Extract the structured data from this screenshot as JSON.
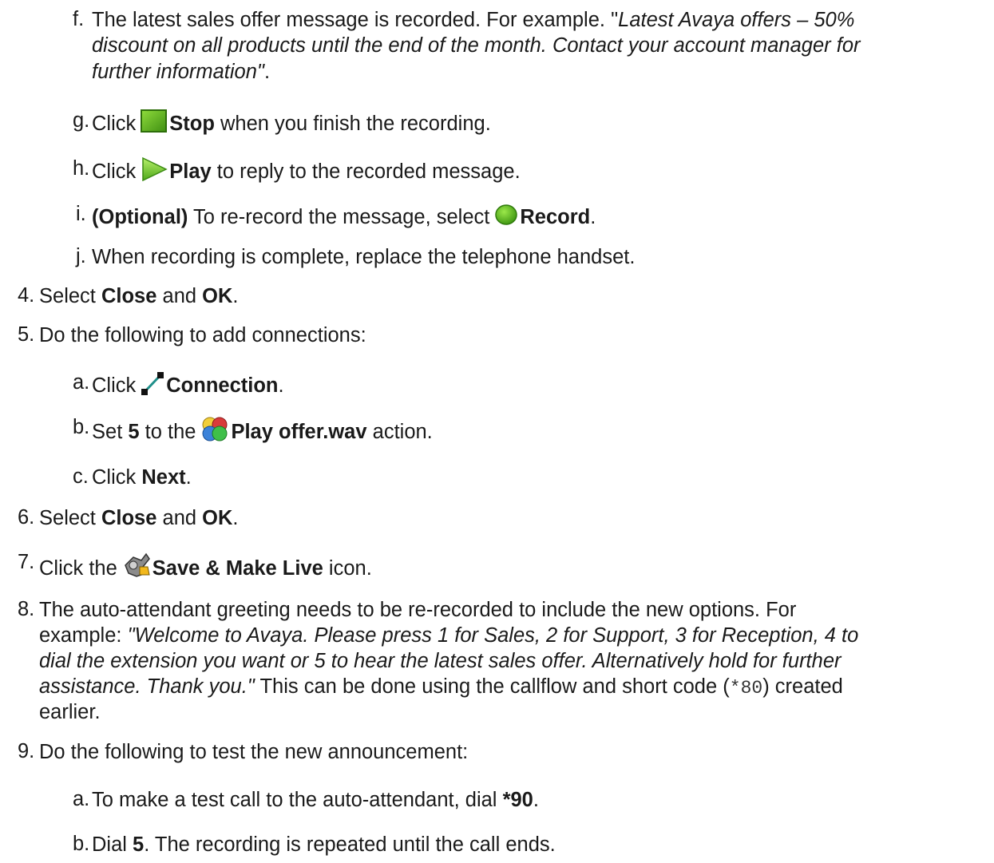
{
  "top_steps": [
    {
      "marker": "f.",
      "lines": [
        [
          "The latest sales offer message is recorded. For example. \"",
          "Latest Avaya offers – 50%"
        ],
        [
          "discount on all products until the end of the month. Contact your account manager for"
        ],
        [
          "further information\"",
          "."
        ]
      ]
    },
    {
      "marker": "g.",
      "before": "Click",
      "icon": "stop-square-icon",
      "bold": "Stop",
      "after": " when you finish the recording.",
      "icon_color": "#5fb41e"
    },
    {
      "marker": "h.",
      "before": "Click",
      "icon": "play-triangle-icon",
      "bold": "Play",
      "after": " to reply to the recorded message.",
      "icon_color": "#7ac943"
    },
    {
      "marker": "i.",
      "bold_lead": "(Optional)",
      "before": " To re-record the message, select",
      "icon": "record-circle-icon",
      "bold": "Record",
      "after": ".",
      "icon_color": "#6cc01f"
    },
    {
      "marker": "j.",
      "text": "When recording is complete, replace the telephone handset."
    }
  ],
  "step4": {
    "marker": "4.",
    "before": "Select ",
    "b1": "Close",
    "mid": " and ",
    "b2": "OK",
    "after": "."
  },
  "step5": {
    "marker": "5.",
    "text": "Do the following to add connections:",
    "subs": [
      {
        "marker": "a.",
        "before": "Click",
        "icon": "connection-line-icon",
        "bold": "Connection",
        "after": "."
      },
      {
        "marker": "b.",
        "before": "Set ",
        "b_num": "5",
        "mid": " to the",
        "icon": "action-puzzle-icon",
        "bold": "Play offer.wav",
        "after": " action."
      },
      {
        "marker": "c.",
        "before": "Click ",
        "bold": "Next",
        "after": "."
      }
    ]
  },
  "step6": {
    "marker": "6.",
    "before": "Select ",
    "b1": "Close",
    "mid": " and ",
    "b2": "OK",
    "after": "."
  },
  "step7": {
    "marker": "7.",
    "before": "Click the",
    "icon": "save-make-live-icon",
    "bold": "Save & Make Live",
    "after": " icon."
  },
  "step8": {
    "marker": "8.",
    "l1": "The auto-attendant greeting needs to be re-recorded to include the new options. For",
    "l2a": "example: ",
    "l2b": "\"Welcome to Avaya. Please press 1 for Sales, 2 for Support, 3 for Reception, 4 to",
    "l3": "dial the extension you want or 5 to hear the latest sales offer. Alternatively hold for further",
    "l4a": "assistance. Thank you.\"",
    "l4b": " This can be done using the callflow and short code (",
    "l4code": "*80",
    "l4c": ") created",
    "l5": "earlier."
  },
  "step9": {
    "marker": "9.",
    "text": "Do the following to test the new announcement:",
    "subs": [
      {
        "marker": "a.",
        "before": "To make a test call to the auto-attendant, dial ",
        "bold": "*90",
        "after": "."
      },
      {
        "marker": "b.",
        "before": "Dial ",
        "bold": "5",
        "after": ". The recording is repeated until the call ends."
      }
    ]
  }
}
